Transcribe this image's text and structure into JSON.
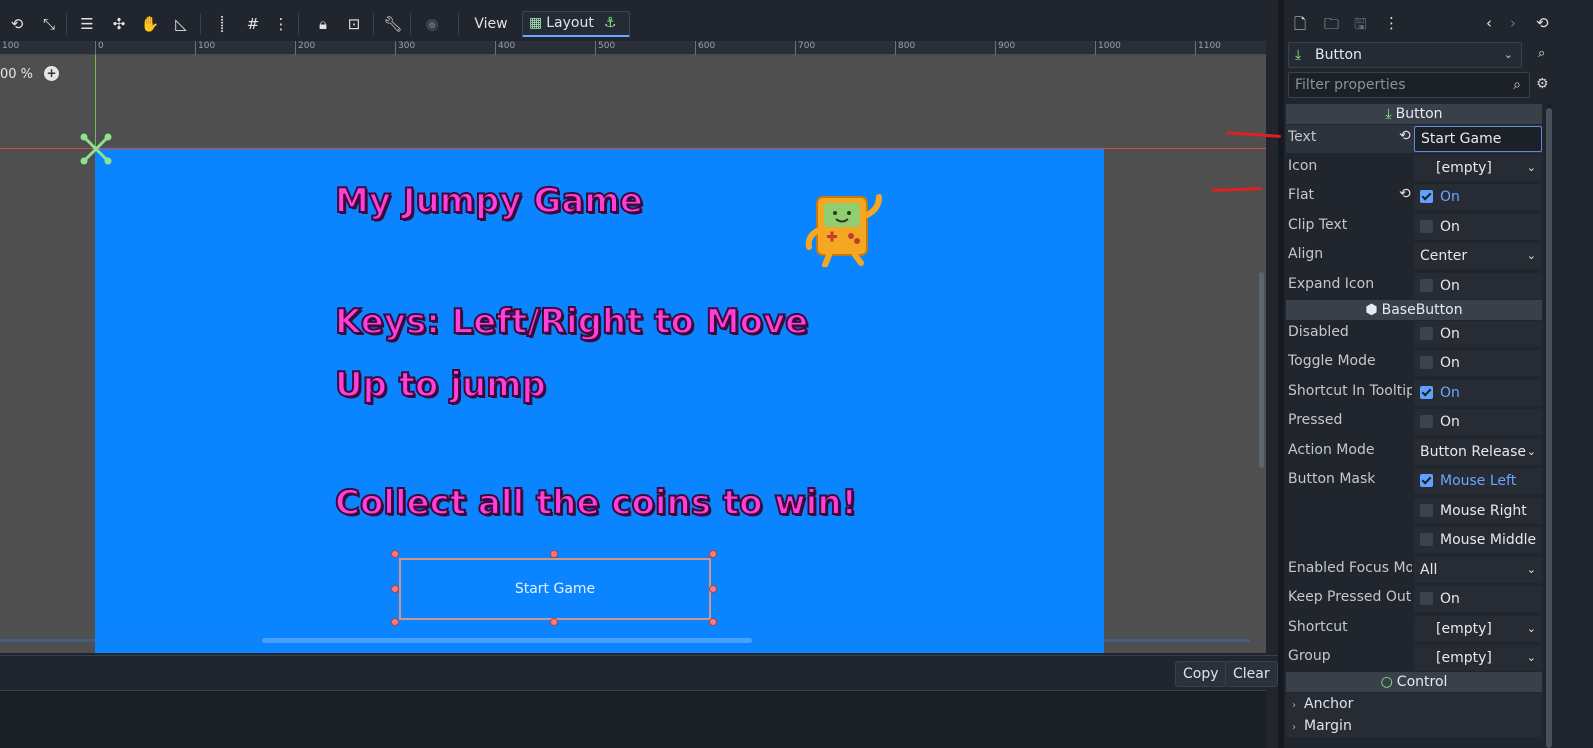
{
  "toolbar": {
    "view_label": "View",
    "layout_label": "Layout"
  },
  "ruler": {
    "ticks": [
      "100",
      "0",
      "100",
      "200",
      "300",
      "400",
      "500",
      "600",
      "700",
      "800",
      "900",
      "1000",
      "1100"
    ]
  },
  "canvas": {
    "zoom": "00 %",
    "lines": [
      "My Jumpy  Game",
      "Keys: Left/Right to Move",
      "Up to jump",
      "Collect all the coins to win!"
    ],
    "button_text": "Start Game"
  },
  "bottom": {
    "copy_label": "Copy",
    "clear_label": "Clear"
  },
  "inspector": {
    "node_type": "Button",
    "filter_placeholder": "Filter properties",
    "categories": {
      "button": "Button",
      "base_button": "BaseButton",
      "control": "Control"
    },
    "props": {
      "text": {
        "label": "Text",
        "value": "Start Game"
      },
      "icon": {
        "label": "Icon",
        "value": "[empty]"
      },
      "flat": {
        "label": "Flat",
        "value": "On"
      },
      "clip_text": {
        "label": "Clip Text",
        "value": "On"
      },
      "align": {
        "label": "Align",
        "value": "Center"
      },
      "expand_icon": {
        "label": "Expand Icon",
        "value": "On"
      },
      "disabled": {
        "label": "Disabled",
        "value": "On"
      },
      "toggle_mode": {
        "label": "Toggle Mode",
        "value": "On"
      },
      "shortcut_in_tooltip": {
        "label": "Shortcut In Tooltip",
        "value": "On"
      },
      "pressed": {
        "label": "Pressed",
        "value": "On"
      },
      "action_mode": {
        "label": "Action Mode",
        "value": "Button Release"
      },
      "button_mask": {
        "label": "Button Mask",
        "left": "Mouse Left",
        "right": "Mouse Right",
        "middle": "Mouse Middle"
      },
      "enabled_focus": {
        "label": "Enabled Focus Mo",
        "value": "All"
      },
      "keep_pressed": {
        "label": "Keep Pressed Out",
        "value": "On"
      },
      "shortcut": {
        "label": "Shortcut",
        "value": "[empty]"
      },
      "group": {
        "label": "Group",
        "value": "[empty]"
      }
    },
    "subsections": {
      "anchor": "Anchor",
      "margin": "Margin"
    }
  },
  "colors": {
    "editor_bg": "#21262e",
    "game_bg": "#0a84ff",
    "title_text": "#ff3fd8",
    "accent": "#6ba7ff",
    "selection": "#d2958a"
  }
}
